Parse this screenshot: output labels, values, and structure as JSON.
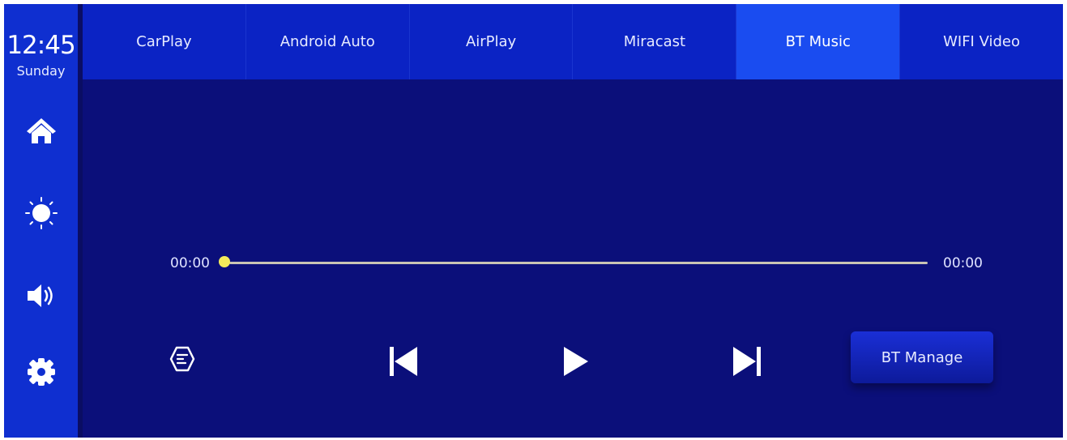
{
  "status": {
    "time": "12:45",
    "day": "Sunday"
  },
  "sidebar": {
    "items": [
      {
        "name": "home",
        "icon": "home-icon"
      },
      {
        "name": "brightness",
        "icon": "brightness-icon"
      },
      {
        "name": "volume",
        "icon": "volume-icon"
      },
      {
        "name": "settings",
        "icon": "gear-icon"
      }
    ]
  },
  "tabs": [
    {
      "label": "CarPlay",
      "active": false
    },
    {
      "label": "Android Auto",
      "active": false
    },
    {
      "label": "AirPlay",
      "active": false
    },
    {
      "label": "Miracast",
      "active": false
    },
    {
      "label": "BT Music",
      "active": true
    },
    {
      "label": "WIFI Video",
      "active": false
    }
  ],
  "player": {
    "elapsed": "00:00",
    "duration": "00:00",
    "progress": 0,
    "controls": {
      "playlist_icon": "playlist-icon",
      "prev_icon": "skip-previous-icon",
      "play_icon": "play-icon",
      "next_icon": "skip-next-icon"
    },
    "bt_manage_label": "BT Manage"
  },
  "colors": {
    "background": "#0b0f7a",
    "sidebar": "#0f2fd0",
    "tab_bar": "#0b23c4",
    "tab_active": "#1a4cf0",
    "progress_knob": "#f4ec5a"
  }
}
